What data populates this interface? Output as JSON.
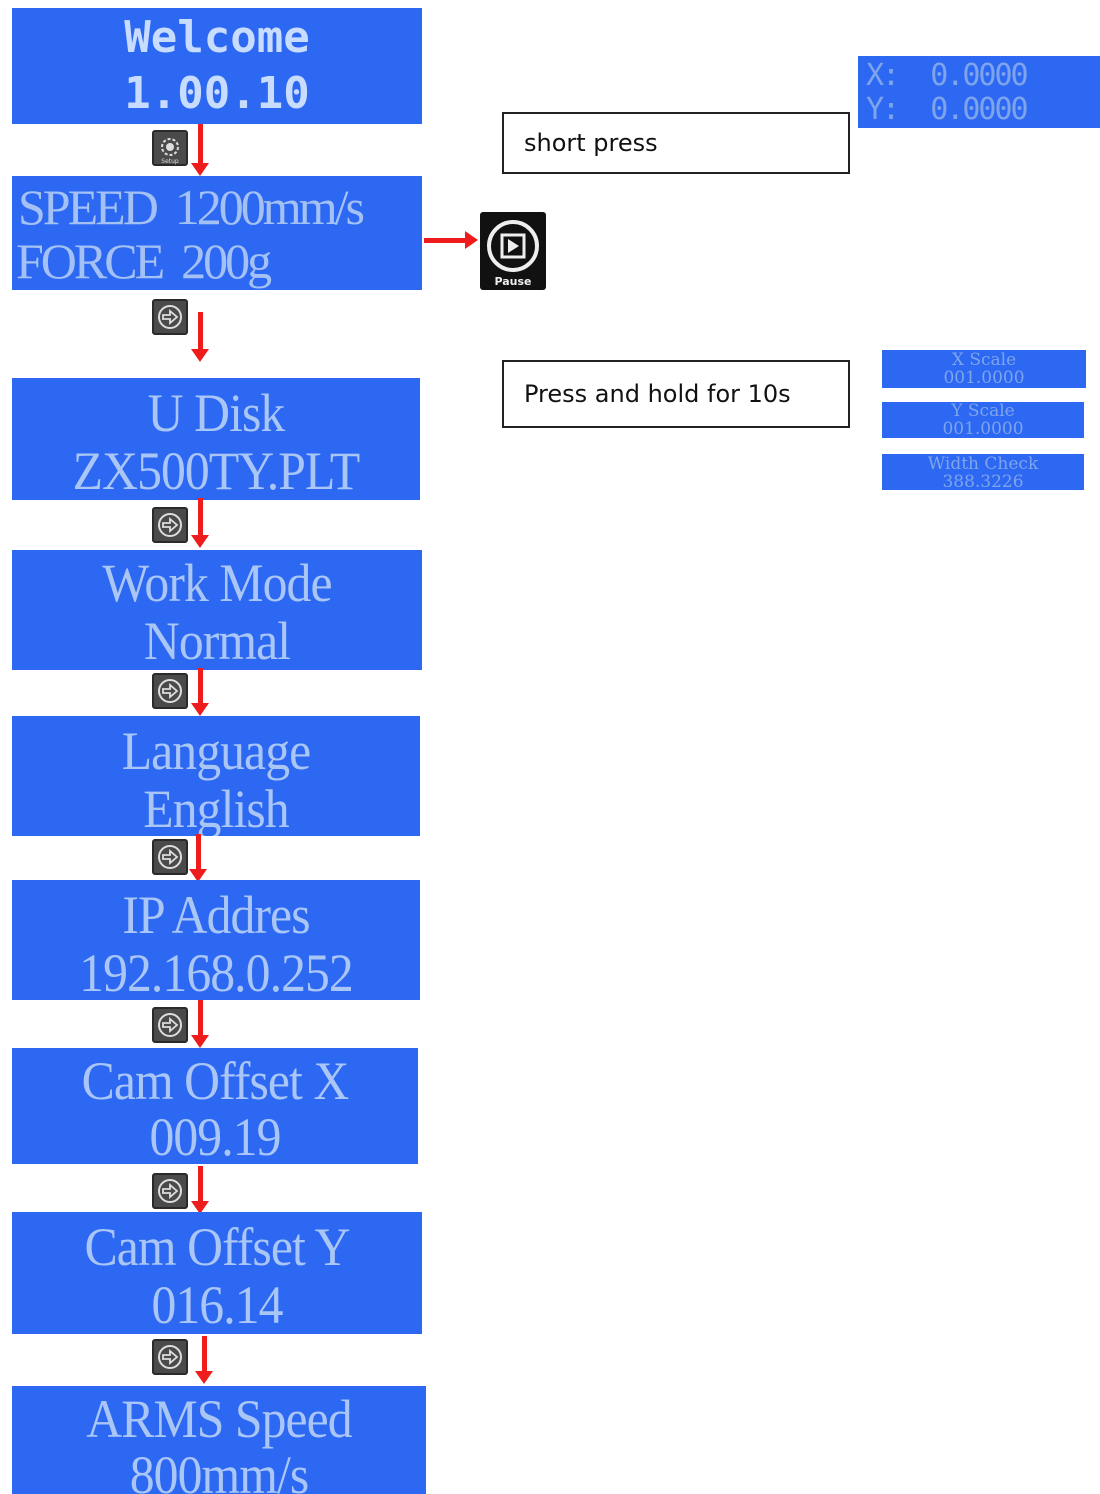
{
  "screens": {
    "welcome": {
      "line1": "Welcome",
      "line2": "1.00.10"
    },
    "speed": {
      "line1": "SPEED  1200mm/s",
      "line2": "FORCE  200g"
    },
    "udisk": {
      "line1": "U Disk",
      "line2": "ZX500TY.PLT"
    },
    "workmode": {
      "line1": "Work Mode",
      "line2": "Normal"
    },
    "language": {
      "line1": "Language",
      "line2": "English"
    },
    "ip": {
      "line1": "IP Addres",
      "line2": "192.168.0.252"
    },
    "camx": {
      "line1": "Cam Offset X",
      "line2": "009.19"
    },
    "camy": {
      "line1": "Cam Offset Y",
      "line2": "016.14"
    },
    "arms": {
      "line1": "ARMS Speed",
      "line2": "800mm/s"
    }
  },
  "coords": {
    "x": "X:  0.0000",
    "y": "Y:  0.0000"
  },
  "labels": {
    "short_press": "short press",
    "hold": "Press and hold for 10s"
  },
  "buttons": {
    "setup": "Setup",
    "pause": "Pause"
  },
  "mini_screens": [
    {
      "line1": "X Scale",
      "line2": "001.0000"
    },
    {
      "line1": "Y Scale",
      "line2": "001.0000"
    },
    {
      "line1": "Width Check",
      "line2": "388.3226"
    }
  ],
  "icons": [
    "gear-icon",
    "next-arrow-icon",
    "pause-play-icon"
  ],
  "colors": {
    "lcd_bg": "#2d68f2",
    "lcd_text": "#a9c6f7",
    "arrow": "#ee1c1c"
  }
}
